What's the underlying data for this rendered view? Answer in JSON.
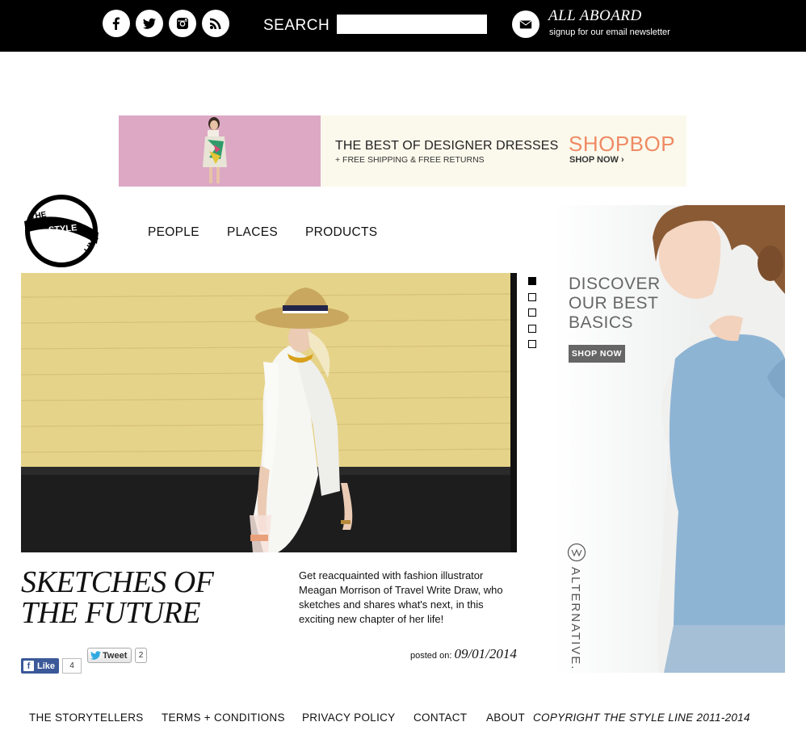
{
  "topbar": {
    "icons": [
      "facebook-icon",
      "twitter-icon",
      "instagram-icon",
      "rss-icon",
      "mail-icon"
    ],
    "search_label": "SEARCH",
    "search_value": "",
    "newsletter_title": "ALL ABOARD",
    "newsletter_sub": "signup for our email newsletter"
  },
  "banner": {
    "headline": "THE BEST OF DESIGNER DRESSES",
    "subline": "+ FREE SHIPPING & FREE RETURNS",
    "brand": "SHOPBOP",
    "cta": "SHOP NOW ›",
    "brand_color": "#ef8a64"
  },
  "logo": {
    "text_line1": "THE",
    "text_line2": "STYLE",
    "text_line3": "LINE"
  },
  "nav": {
    "items": [
      "PEOPLE",
      "PLACES",
      "PRODUCTS"
    ]
  },
  "slider": {
    "count": 5,
    "active_index": 1
  },
  "article": {
    "title_line1": "SKETCHES OF",
    "title_line2": "THE FUTURE",
    "description": "Get reacquainted with fashion illustrator Meagan Morrison of Travel Write Draw, who sketches and shares what's next, in this exciting new chapter of her life!",
    "posted_label": "posted on:",
    "posted_date": "09/01/2014"
  },
  "social_share": {
    "like_label": "Like",
    "like_count": "4",
    "tweet_label": "Tweet",
    "tweet_count": "2"
  },
  "side_ad": {
    "title_line1": "DISCOVER",
    "title_line2": "OUR BEST",
    "title_line3": "BASICS",
    "button": "SHOP NOW",
    "brand": "ALTERNATIVE."
  },
  "footer": {
    "links": [
      "THE STORYTELLERS",
      "TERMS + CONDITIONS",
      "PRIVACY POLICY",
      "CONTACT",
      "ABOUT"
    ],
    "copyright": "COPYRIGHT THE STYLE LINE 2011-2014"
  },
  "colors": {
    "topbar": "#000000",
    "fb_blue": "#3b5998",
    "hero_wall": "#e8d58c"
  }
}
